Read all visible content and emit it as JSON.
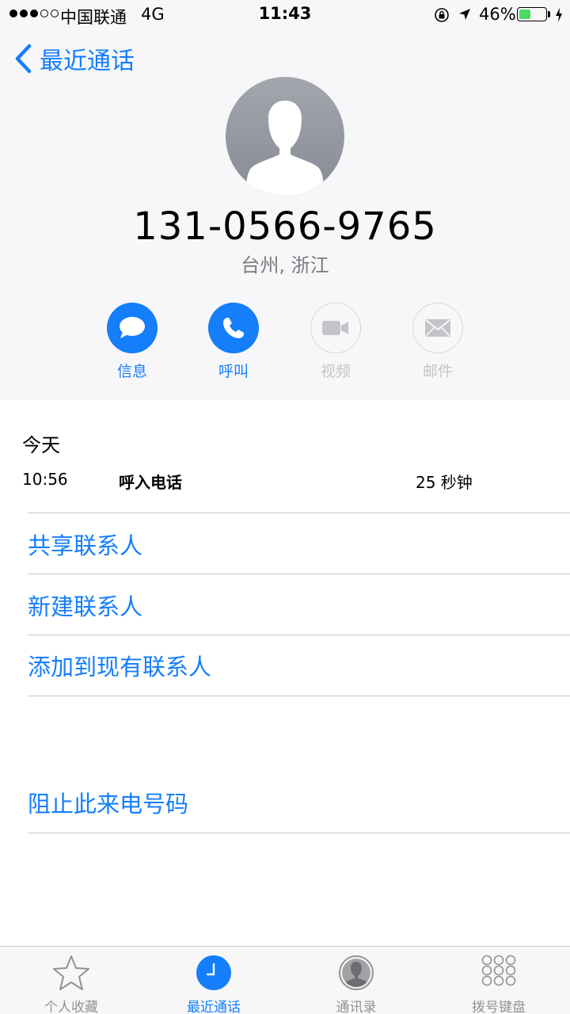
{
  "status_bar": {
    "carrier": "中国联通",
    "network": "4G",
    "time": "11:43",
    "battery_percent": "46%",
    "battery_level": 0.46
  },
  "nav": {
    "back_label": "最近通话"
  },
  "contact": {
    "phone_number": "131-0566-9765",
    "location": "台州, 浙江"
  },
  "actions": [
    {
      "label": "信息",
      "icon": "message-icon",
      "enabled": true
    },
    {
      "label": "呼叫",
      "icon": "phone-icon",
      "enabled": true
    },
    {
      "label": "视频",
      "icon": "video-icon",
      "enabled": false
    },
    {
      "label": "邮件",
      "icon": "mail-icon",
      "enabled": false
    }
  ],
  "recents": {
    "section_title": "今天",
    "entries": [
      {
        "time": "10:56",
        "type": "呼入电话",
        "duration": "25 秒钟"
      }
    ]
  },
  "options": {
    "share_contact": "共享联系人",
    "new_contact": "新建联系人",
    "add_to_existing": "添加到现有联系人",
    "block_caller": "阻止此来电号码"
  },
  "tab_bar": {
    "tabs": [
      {
        "label": "个人收藏",
        "icon": "star-icon",
        "selected": false
      },
      {
        "label": "最近通话",
        "icon": "clock-icon",
        "selected": true
      },
      {
        "label": "通讯录",
        "icon": "contacts-icon",
        "selected": false
      },
      {
        "label": "拨号键盘",
        "icon": "keypad-icon",
        "selected": false
      }
    ]
  },
  "colors": {
    "accent": "#147efb",
    "header_bg": "#f7f7f9",
    "secondary_text": "#7b7b80",
    "disabled": "#c4c4c8"
  }
}
